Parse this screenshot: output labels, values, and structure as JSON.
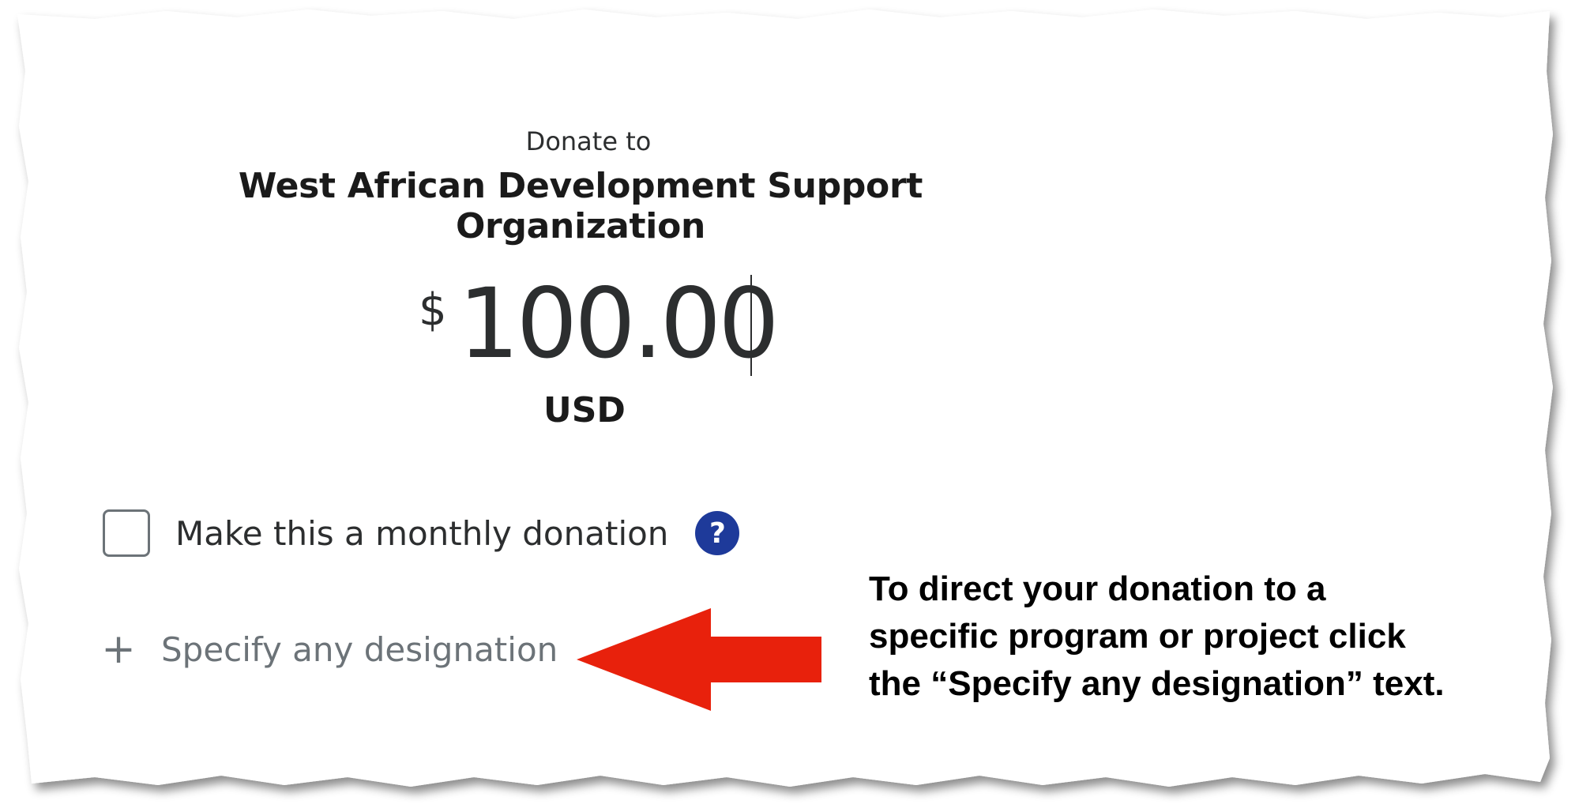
{
  "header": {
    "donate_to_label": "Donate to",
    "organization_name": "West African Development Support Organization"
  },
  "amount": {
    "currency_symbol": "$",
    "value": "100.00",
    "currency_code": "USD"
  },
  "monthly": {
    "label": "Make this a monthly donation",
    "checked": false,
    "help_icon": "question-icon",
    "help_glyph": "?"
  },
  "designation": {
    "plus_glyph": "+",
    "label": "Specify any designation"
  },
  "annotation": {
    "lines": [
      "To direct your donation to a",
      "specific program or project click",
      "the “Specify any designation” text."
    ],
    "arrow_color": "#e8210c"
  },
  "colors": {
    "help_icon_bg": "#1e3a9a",
    "text_dark": "#2c2e2f",
    "text_muted": "#6c7378"
  }
}
